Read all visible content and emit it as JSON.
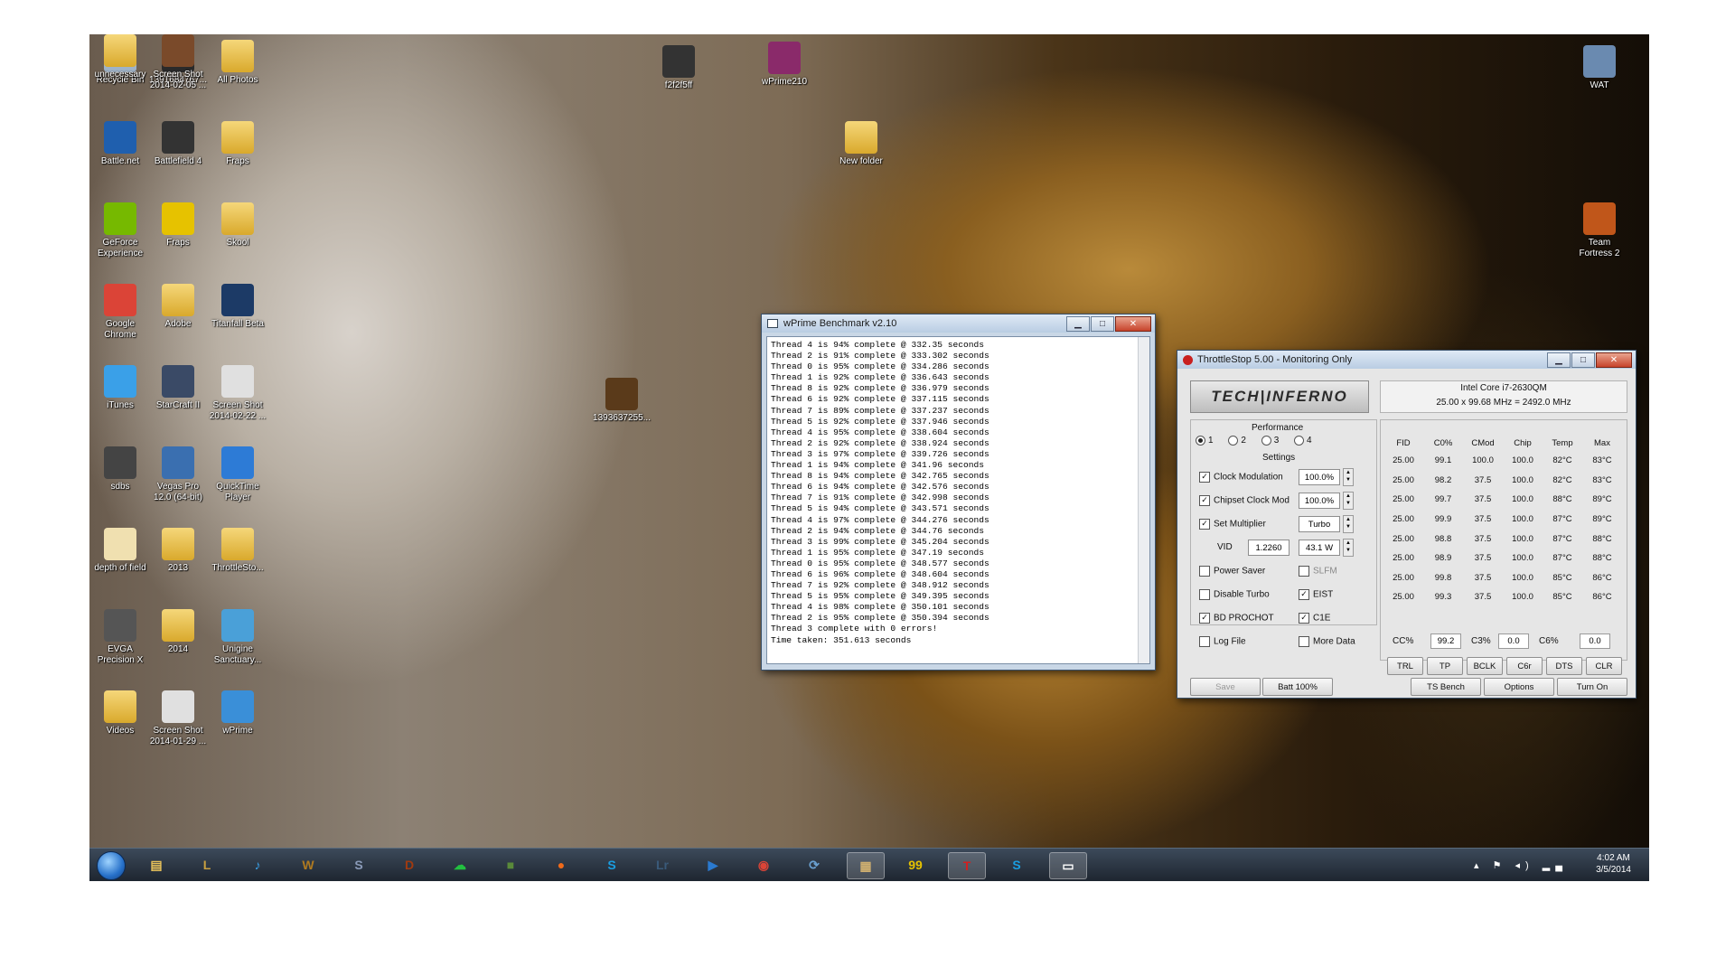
{
  "desktop": {
    "icons": [
      {
        "label": "Recycle Bin",
        "icon": "recycle-bin-icon",
        "color": "#9fb3c8"
      },
      {
        "label": "1391684767...",
        "icon": "image-file-icon",
        "color": "#2a2a2a"
      },
      {
        "label": "All Photos",
        "icon": "folder-icon",
        "color": "#e8c25a"
      },
      {
        "label": "Battle.net",
        "icon": "battlenet-icon",
        "color": "#1f5fae"
      },
      {
        "label": "Battlefield 4",
        "icon": "battlefield-icon",
        "color": "#333333"
      },
      {
        "label": "Fraps",
        "icon": "folder-icon",
        "color": "#e8c25a"
      },
      {
        "label": "GeForce\nExperience",
        "icon": "geforce-icon",
        "color": "#76b900"
      },
      {
        "label": "Fraps",
        "icon": "fraps-icon",
        "color": "#e6c200"
      },
      {
        "label": "Skool",
        "icon": "folder-icon",
        "color": "#e8c25a"
      },
      {
        "label": "Google\nChrome",
        "icon": "chrome-icon",
        "color": "#db4437"
      },
      {
        "label": "Adobe",
        "icon": "folder-icon",
        "color": "#e8c25a"
      },
      {
        "label": "Titanfall Beta",
        "icon": "titanfall-icon",
        "color": "#1c3a66"
      },
      {
        "label": "iTunes",
        "icon": "itunes-icon",
        "color": "#3aa0e8"
      },
      {
        "label": "StarCraft II",
        "icon": "starcraft-icon",
        "color": "#3a4a66"
      },
      {
        "label": "Screen Shot\n2014-02-22 ...",
        "icon": "screenshot-icon",
        "color": "#e0e0e0"
      },
      {
        "label": "sdbs",
        "icon": "archive-icon",
        "color": "#444444"
      },
      {
        "label": "Vegas Pro\n12.0 (64-bit)",
        "icon": "vegas-icon",
        "color": "#3a6fb0"
      },
      {
        "label": "QuickTime\nPlayer",
        "icon": "quicktime-icon",
        "color": "#2d7bd6"
      },
      {
        "label": "depth of field",
        "icon": "document-icon",
        "color": "#f0e0b0"
      },
      {
        "label": "2013",
        "icon": "folder-icon",
        "color": "#e8c25a"
      },
      {
        "label": "ThrottleSto...",
        "icon": "folder-icon",
        "color": "#e8c25a"
      },
      {
        "label": "EVGA\nPrecision X",
        "icon": "evga-icon",
        "color": "#555555"
      },
      {
        "label": "2014",
        "icon": "folder-icon",
        "color": "#e8c25a"
      },
      {
        "label": "Unigine\nSanctuary...",
        "icon": "unigine-icon",
        "color": "#4aa0d8"
      },
      {
        "label": "Videos",
        "icon": "folder-icon",
        "color": "#e8c25a"
      },
      {
        "label": "Screen Shot\n2014-01-29 ...",
        "icon": "screenshot-icon",
        "color": "#e0e0e0"
      },
      {
        "label": "wPrime",
        "icon": "wprime-icon",
        "color": "#3a8fd8"
      },
      {
        "label": "unnecessary",
        "icon": "folder-icon",
        "color": "#e8c25a"
      },
      {
        "label": "Screen Shot\n2014-02-05 ...",
        "icon": "screenshot-icon",
        "color": "#7a4a2a"
      }
    ],
    "free_icons": [
      {
        "label": "f2f2f5ff",
        "icon": "video-file-icon",
        "color": "#333333"
      },
      {
        "label": "wPrime210",
        "icon": "winrar-icon",
        "color": "#8a2a6a"
      },
      {
        "label": "New folder",
        "icon": "folder-icon",
        "color": "#e8c25a"
      },
      {
        "label": "1393637255...",
        "icon": "image-file-icon",
        "color": "#5a3a1a"
      },
      {
        "label": "WAT",
        "icon": "image-file-icon",
        "color": "#6a8ab0"
      },
      {
        "label": "Team\nFortress 2",
        "icon": "tf2-icon",
        "color": "#c0561a"
      }
    ]
  },
  "wprime": {
    "title": "wPrime Benchmark v2.10",
    "lines": [
      "Thread 4 is 94% complete @ 332.35 seconds",
      "Thread 2 is 91% complete @ 333.302 seconds",
      "Thread 0 is 95% complete @ 334.286 seconds",
      "Thread 1 is 92% complete @ 336.643 seconds",
      "Thread 8 is 92% complete @ 336.979 seconds",
      "Thread 6 is 92% complete @ 337.115 seconds",
      "Thread 7 is 89% complete @ 337.237 seconds",
      "Thread 5 is 92% complete @ 337.946 seconds",
      "Thread 4 is 95% complete @ 338.604 seconds",
      "Thread 2 is 92% complete @ 338.924 seconds",
      "Thread 3 is 97% complete @ 339.726 seconds",
      "Thread 1 is 94% complete @ 341.96 seconds",
      "Thread 8 is 94% complete @ 342.765 seconds",
      "Thread 6 is 94% complete @ 342.576 seconds",
      "Thread 7 is 91% complete @ 342.998 seconds",
      "Thread 5 is 94% complete @ 343.571 seconds",
      "Thread 4 is 97% complete @ 344.276 seconds",
      "Thread 2 is 94% complete @ 344.76 seconds",
      "Thread 3 is 99% complete @ 345.204 seconds",
      "Thread 1 is 95% complete @ 347.19 seconds",
      "Thread 0 is 95% complete @ 348.577 seconds",
      "Thread 6 is 96% complete @ 348.604 seconds",
      "Thread 7 is 92% complete @ 348.912 seconds",
      "Thread 5 is 95% complete @ 349.395 seconds",
      "Thread 4 is 98% complete @ 350.101 seconds",
      "Thread 2 is 95% complete @ 350.394 seconds",
      "Thread 3 complete with 0 errors!",
      "Time taken: 351.613 seconds"
    ]
  },
  "throttlestop": {
    "title": "ThrottleStop 5.00 - Monitoring Only",
    "logo": "TECH|INFERNO",
    "cpu_name": "Intel Core i7-2630QM",
    "cpu_freq": "25.00 x 99.68 MHz = 2492.0 MHz",
    "performance_label": "Performance",
    "profiles": [
      "1",
      "2",
      "3",
      "4"
    ],
    "settings_label": "Settings",
    "clock_modulation": {
      "label": "Clock Modulation",
      "value": "100.0%",
      "checked": true
    },
    "chipset_clock_mod": {
      "label": "Chipset Clock Mod",
      "value": "100.0%",
      "checked": true
    },
    "set_multiplier": {
      "label": "Set Multiplier",
      "value": "Turbo",
      "checked": true
    },
    "vid": {
      "label": "VID",
      "value": "1.2260",
      "power": "43.1 W"
    },
    "options": [
      {
        "label": "Power Saver",
        "checked": false
      },
      {
        "label": "SLFM",
        "checked": false
      },
      {
        "label": "Disable Turbo",
        "checked": false
      },
      {
        "label": "EIST",
        "checked": true
      },
      {
        "label": "BD PROCHOT",
        "checked": true
      },
      {
        "label": "C1E",
        "checked": true
      },
      {
        "label": "Log File",
        "checked": false
      },
      {
        "label": "More Data",
        "checked": false
      }
    ],
    "columns": [
      "FID",
      "C0%",
      "CMod",
      "Chip",
      "Temp",
      "Max"
    ],
    "rows": [
      [
        "25.00",
        "99.1",
        "100.0",
        "100.0",
        "82°C",
        "83°C"
      ],
      [
        "25.00",
        "98.2",
        "37.5",
        "100.0",
        "82°C",
        "83°C"
      ],
      [
        "25.00",
        "99.7",
        "37.5",
        "100.0",
        "88°C",
        "89°C"
      ],
      [
        "25.00",
        "99.9",
        "37.5",
        "100.0",
        "87°C",
        "89°C"
      ],
      [
        "25.00",
        "98.8",
        "37.5",
        "100.0",
        "87°C",
        "88°C"
      ],
      [
        "25.00",
        "98.9",
        "37.5",
        "100.0",
        "87°C",
        "88°C"
      ],
      [
        "25.00",
        "99.8",
        "37.5",
        "100.0",
        "85°C",
        "86°C"
      ],
      [
        "25.00",
        "99.3",
        "37.5",
        "100.0",
        "85°C",
        "86°C"
      ]
    ],
    "summary": [
      {
        "label": "CC%",
        "value": "99.2"
      },
      {
        "label": "C3%",
        "value": "0.0"
      },
      {
        "label": "C6%",
        "value": "0.0"
      }
    ],
    "mini_buttons": [
      "TRL",
      "TP",
      "BCLK",
      "C6r",
      "DTS",
      "CLR"
    ],
    "bottom_buttons": {
      "save": "Save",
      "batt": "Batt 100%",
      "bench": "TS Bench",
      "options": "Options",
      "turn_on": "Turn On"
    }
  },
  "taskbar": {
    "apps": [
      {
        "icon": "explorer-icon",
        "glyph": "▤",
        "color": "#e8c25a"
      },
      {
        "icon": "league-icon",
        "glyph": "L",
        "color": "#c8a040"
      },
      {
        "icon": "itunes-icon",
        "glyph": "♪",
        "color": "#3aa0e8"
      },
      {
        "icon": "wow-icon",
        "glyph": "W",
        "color": "#b07a20"
      },
      {
        "icon": "starcraft-icon",
        "glyph": "S",
        "color": "#8a9ab8"
      },
      {
        "icon": "diablo-icon",
        "glyph": "D",
        "color": "#a03a10"
      },
      {
        "icon": "cloud-icon",
        "glyph": "☁",
        "color": "#22c040"
      },
      {
        "icon": "minecraft-icon",
        "glyph": "■",
        "color": "#5a8a3a"
      },
      {
        "icon": "origin-icon",
        "glyph": "●",
        "color": "#f06a1a"
      },
      {
        "icon": "skype-icon",
        "glyph": "S",
        "color": "#1a9de0"
      },
      {
        "icon": "lightroom-icon",
        "glyph": "Lr",
        "color": "#3a5a7a"
      },
      {
        "icon": "vegas-icon",
        "glyph": "▶",
        "color": "#2a7ad0"
      },
      {
        "icon": "chrome-icon",
        "glyph": "◉",
        "color": "#db4437"
      },
      {
        "icon": "network-icon",
        "glyph": "⟳",
        "color": "#6aa0d0"
      },
      {
        "icon": "image-viewer-icon",
        "glyph": "▦",
        "color": "#d0b070"
      },
      {
        "icon": "fraps-icon",
        "glyph": "99",
        "color": "#e6c200"
      },
      {
        "icon": "throttlestop-icon",
        "glyph": "T",
        "color": "#d02020"
      },
      {
        "icon": "skype-icon",
        "glyph": "S",
        "color": "#1a9de0"
      },
      {
        "icon": "wprime-window-icon",
        "glyph": "▭",
        "color": "#ffffff"
      }
    ],
    "tray": "▴ ⚑ ◂) ▂▄",
    "time": "4:02 AM",
    "date": "3/5/2014"
  }
}
